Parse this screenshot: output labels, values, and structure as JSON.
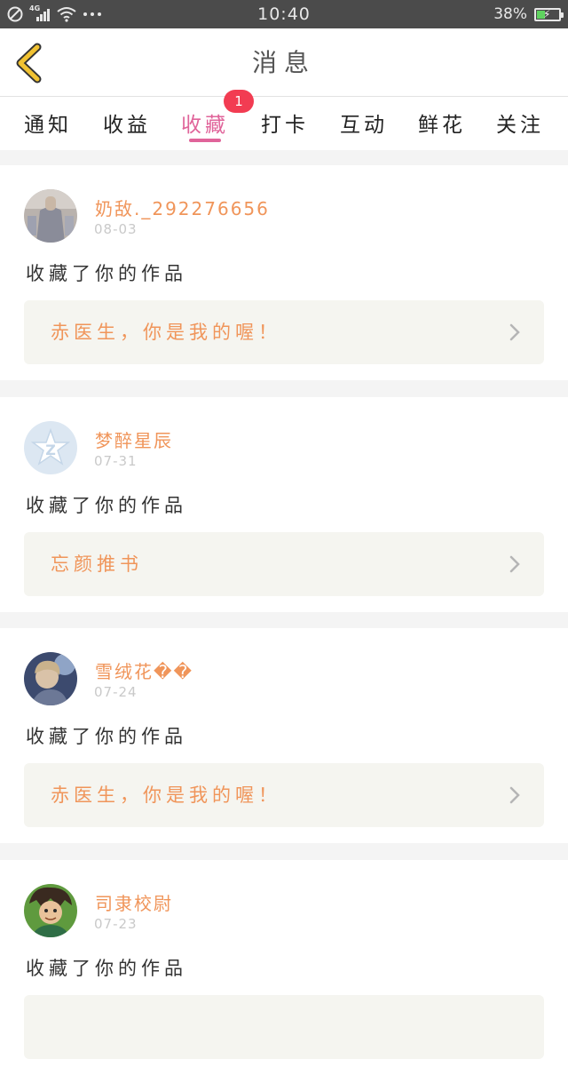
{
  "status_bar": {
    "network": "4G",
    "time": "10:40",
    "battery": "38%",
    "battery_level": 0.38
  },
  "header": {
    "title": "消息"
  },
  "tabs": [
    {
      "label": "通知"
    },
    {
      "label": "收益"
    },
    {
      "label": "收藏",
      "badge": "1",
      "active": true
    },
    {
      "label": "打卡"
    },
    {
      "label": "互动"
    },
    {
      "label": "鲜花"
    },
    {
      "label": "关注"
    }
  ],
  "messages": [
    {
      "username": "奶敌._292276656",
      "date": "08-03",
      "action": "收藏了你的作品",
      "work": "赤医生，你是我的喔！"
    },
    {
      "username": "梦醉星辰",
      "date": "07-31",
      "action": "收藏了你的作品",
      "work": "忘颜推书"
    },
    {
      "username": "雪绒花��",
      "date": "07-24",
      "action": "收藏了你的作品",
      "work": "赤医生，你是我的喔！"
    },
    {
      "username": "司隶校尉",
      "date": "07-23",
      "action": "收藏了你的作品",
      "work": ""
    }
  ],
  "colors": {
    "accent_pink": "#e0649a",
    "badge_red": "#f23c52",
    "name_orange": "#f0955a",
    "back_arrow": "#f1c232"
  },
  "icons": {
    "back": "chevron-left-icon",
    "row_arrow": "chevron-right-icon"
  }
}
